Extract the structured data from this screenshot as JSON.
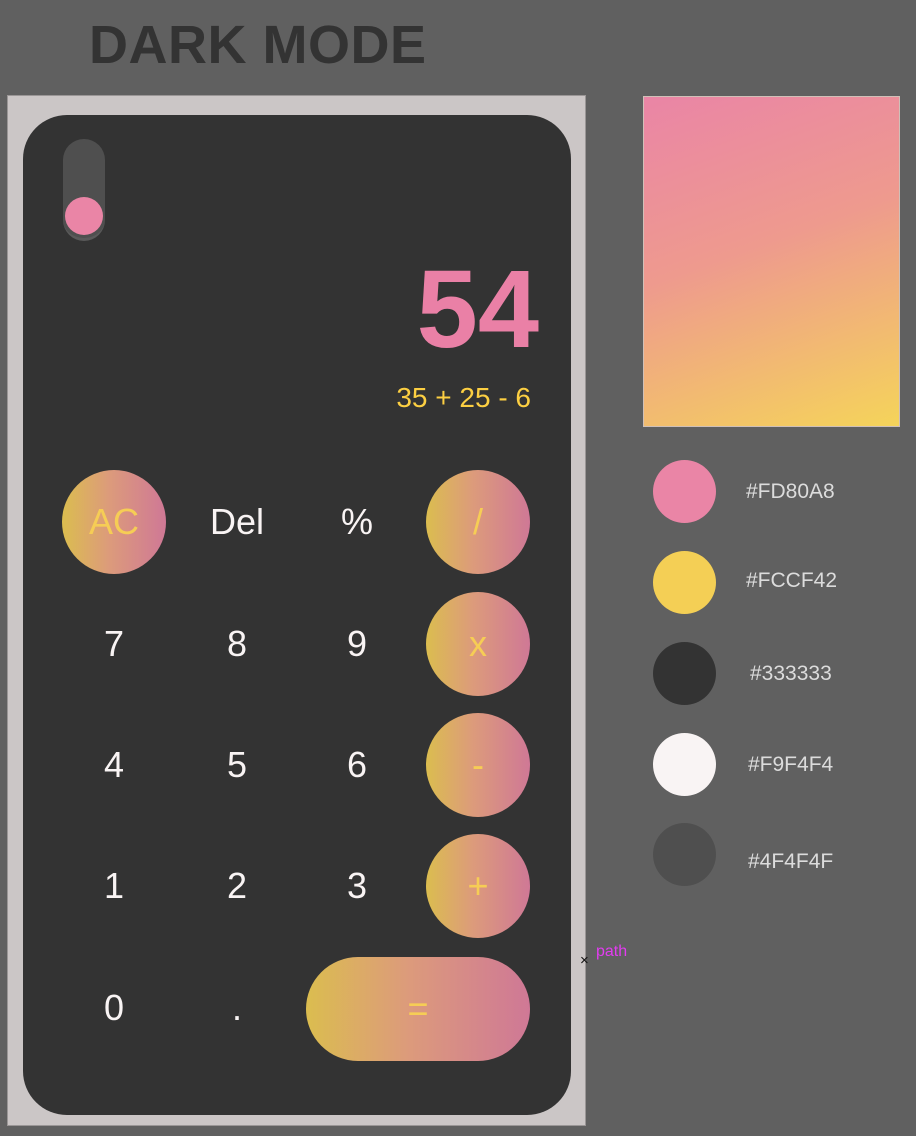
{
  "page": {
    "title": "DARK MODE"
  },
  "calculator": {
    "display": {
      "result": "54",
      "expression": "35 + 25 - 6"
    },
    "keys": {
      "ac": "AC",
      "del": "Del",
      "percent": "%",
      "divide": "/",
      "seven": "7",
      "eight": "8",
      "nine": "9",
      "multiply": "x",
      "four": "4",
      "five": "5",
      "six": "6",
      "minus": "-",
      "one": "1",
      "two": "2",
      "three": "3",
      "plus": "+",
      "zero": "0",
      "dot": ".",
      "equals": "="
    }
  },
  "palette": {
    "swatches": [
      {
        "hex": "#FD80A8",
        "color": "#ea85a6"
      },
      {
        "hex": "#FCCF42",
        "color": "#f4cf55"
      },
      {
        "hex": "#333333",
        "color": "#333333"
      },
      {
        "hex": "#F9F4F4",
        "color": "#f9f4f4"
      },
      {
        "hex": "#4F4F4F",
        "color": "#4f4f4f"
      }
    ]
  },
  "annotation": {
    "marker": "×",
    "label": "path"
  }
}
